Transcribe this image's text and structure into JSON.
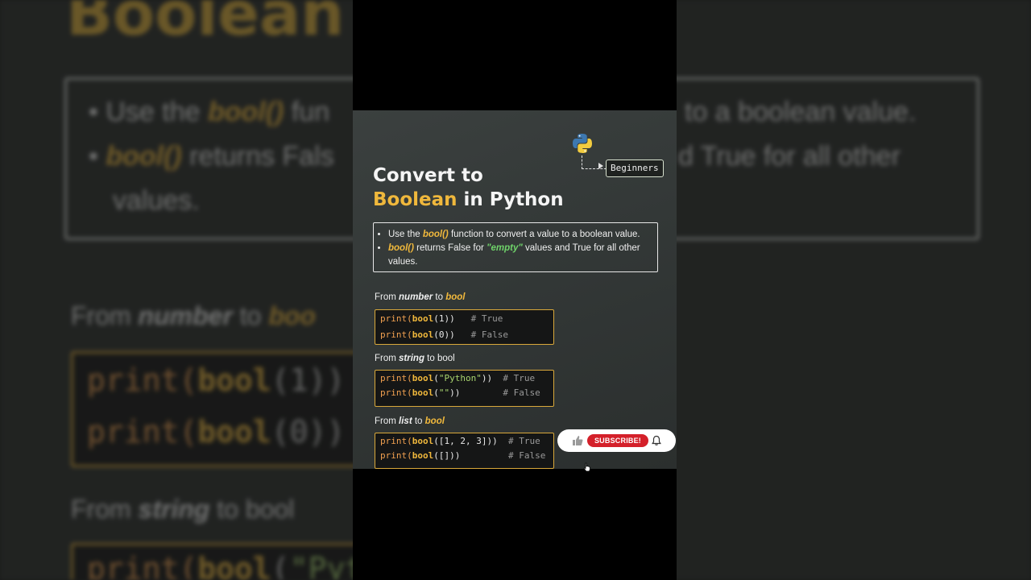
{
  "badge": "Beginners",
  "title": {
    "line1": "Convert to",
    "accent": "Boolean",
    "rest": " in Python"
  },
  "info": {
    "bullet1": {
      "pre": "Use the ",
      "kw": "bool()",
      "post": " function to convert a value to a boolean value."
    },
    "bullet2": {
      "kw": "bool()",
      "mid": " returns False for ",
      "q_open": "\"",
      "green": "empty",
      "q_close": "\"",
      "post": " values and True for all other values."
    }
  },
  "sections": [
    {
      "from": "From ",
      "type": "number",
      "to": " to ",
      "target": "bool",
      "lines": [
        {
          "fn": "print(",
          "b": "bool",
          "args": "(1))",
          "pad": "   ",
          "comment": "# True"
        },
        {
          "fn": "print(",
          "b": "bool",
          "args": "(0))",
          "pad": "   ",
          "comment": "# False"
        }
      ]
    },
    {
      "from": "From ",
      "type": "string",
      "to": " to ",
      "target": "bool",
      "lines": [
        {
          "fn": "print(",
          "b": "bool",
          "open": "(",
          "str": "\"Python\"",
          "close": "))",
          "pad": "  ",
          "comment": "# True"
        },
        {
          "fn": "print(",
          "b": "bool",
          "open": "(",
          "str": "\"\"",
          "close": "))",
          "pad": "        ",
          "comment": "# False"
        }
      ]
    },
    {
      "from": "From ",
      "type": "list",
      "to": " to ",
      "target": "bool",
      "lines": [
        {
          "fn": "print(",
          "b": "bool",
          "args": "([1, 2, 3]))",
          "pad": "  ",
          "comment": "# True"
        },
        {
          "fn": "print(",
          "b": "bool",
          "args": "([]))",
          "pad": "         ",
          "comment": "# False"
        }
      ]
    }
  ],
  "subscribe_label": "SUBSCRIBE!",
  "background": {
    "title": "Boolean",
    "bullet1_pre": "Use the ",
    "bullet1_kw": "bool()",
    "bullet1_post": " fun",
    "bullet1_tail": "to a boolean value.",
    "bullet2_kw": "bool()",
    "bullet2_post": " returns Fals",
    "bullet2_tail": "d True for all other",
    "bullet2_cont": "values.",
    "from_number": "From ",
    "from_number_b": "number",
    "from_number_to": " to ",
    "from_number_t": "boo",
    "code1": "print(",
    "code1_b": "bool",
    "code1_args": "(1))",
    "code2": "print(",
    "code2_b": "bool",
    "code2_args": "(0))",
    "from_string": "From ",
    "from_string_b": "string",
    "from_string_to": " to bool",
    "code3": "print(",
    "code3_b": "bool",
    "code3_args": "(",
    "code3_s": "\"Pyth"
  },
  "colors": {
    "accent": "#f0b83c",
    "green": "#6fd36a",
    "subscribe": "#d4202a"
  }
}
